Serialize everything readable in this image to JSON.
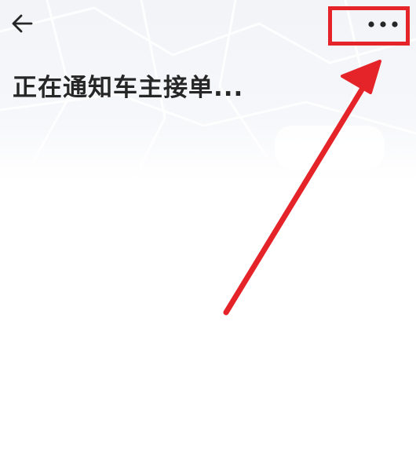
{
  "header": {
    "back_icon": "arrow-left-icon",
    "more_icon": "more-horizontal-icon"
  },
  "status": {
    "title": "正在通知车主接单..."
  },
  "annotation": {
    "color": "#e5242a",
    "target": "more-button"
  }
}
